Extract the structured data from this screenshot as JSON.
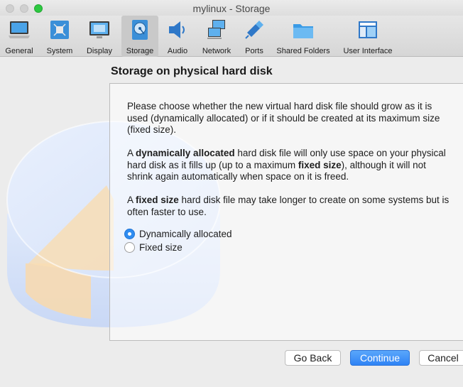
{
  "window": {
    "title": "mylinux - Storage"
  },
  "toolbar": {
    "items": [
      {
        "label": "General",
        "icon": "general-icon"
      },
      {
        "label": "System",
        "icon": "system-icon"
      },
      {
        "label": "Display",
        "icon": "display-icon"
      },
      {
        "label": "Storage",
        "icon": "storage-icon",
        "active": true
      },
      {
        "label": "Audio",
        "icon": "audio-icon"
      },
      {
        "label": "Network",
        "icon": "network-icon"
      },
      {
        "label": "Ports",
        "icon": "ports-icon"
      },
      {
        "label": "Shared Folders",
        "icon": "shared-folders-icon"
      },
      {
        "label": "User Interface",
        "icon": "user-interface-icon"
      }
    ]
  },
  "page": {
    "title": "Storage on physical hard disk"
  },
  "content": {
    "intro": "Please choose whether the new virtual hard disk file should grow as it is used (dynamically allocated) or if it should be created at its maximum size (fixed size).",
    "dynamic_prefix": "A ",
    "dynamic_bold": "dynamically allocated",
    "dynamic_middle": " hard disk file will only use space on your physical hard disk as it fills up (up to a maximum ",
    "dynamic_bold2": "fixed size",
    "dynamic_suffix": "), although it will not shrink again automatically when space on it is freed.",
    "fixed_prefix": "A ",
    "fixed_bold": "fixed size",
    "fixed_suffix": " hard disk file may take longer to create on some systems but is often faster to use."
  },
  "options": {
    "dynamic": {
      "label": "Dynamically allocated",
      "checked": true
    },
    "fixed": {
      "label": "Fixed size",
      "checked": false
    }
  },
  "buttons": {
    "back": "Go Back",
    "continue": "Continue",
    "cancel": "Cancel"
  },
  "colors": {
    "accent": "#2f83f5",
    "window": "#ececec"
  }
}
